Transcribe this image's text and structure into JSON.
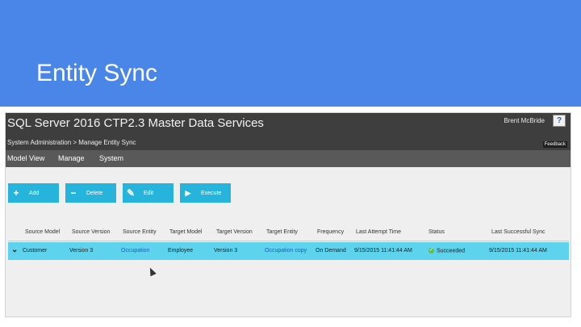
{
  "slide": {
    "title": "Entity Sync"
  },
  "app": {
    "title": "SQL Server 2016 CTP2.3 Master Data Services",
    "breadcrumb": "System Administration > Manage Entity Sync",
    "user": "Brent McBride",
    "help_glyph": "?",
    "feedback": "Feedback"
  },
  "menu": [
    {
      "label": "Model View"
    },
    {
      "label": "Manage"
    },
    {
      "label": "System"
    }
  ],
  "toolbar": [
    {
      "label": "Add",
      "icon": "plus-icon",
      "glyph": "+"
    },
    {
      "label": "Delete",
      "icon": "minus-icon",
      "glyph": "−"
    },
    {
      "label": "Edit",
      "icon": "edit-icon",
      "glyph": "✎"
    },
    {
      "label": "Execute",
      "icon": "play-icon",
      "glyph": "▶"
    }
  ],
  "grid": {
    "columns": [
      "Source Model",
      "Source Version",
      "Source Entity",
      "Target Model",
      "Target Version",
      "Target Entity",
      "Frequency",
      "Last Attempt Time",
      "Status",
      "Last Successful Sync"
    ],
    "rows": [
      {
        "source_model": "Customer",
        "source_version": "Version 3",
        "source_entity": "Occupation",
        "target_model": "Employee",
        "target_version": "Version 3",
        "target_entity": "Occupation copy",
        "frequency": "On Demand",
        "last_attempt": "9/15/2015 11:41:44 AM",
        "status": "Succeeded",
        "last_success": "9/15/2015 11:41:44 AM"
      }
    ]
  },
  "colors": {
    "header_blue": "#4a86e8",
    "button_blue": "#26b4dd",
    "selected_row": "#5dd3ee",
    "link": "#1a5fb4"
  }
}
